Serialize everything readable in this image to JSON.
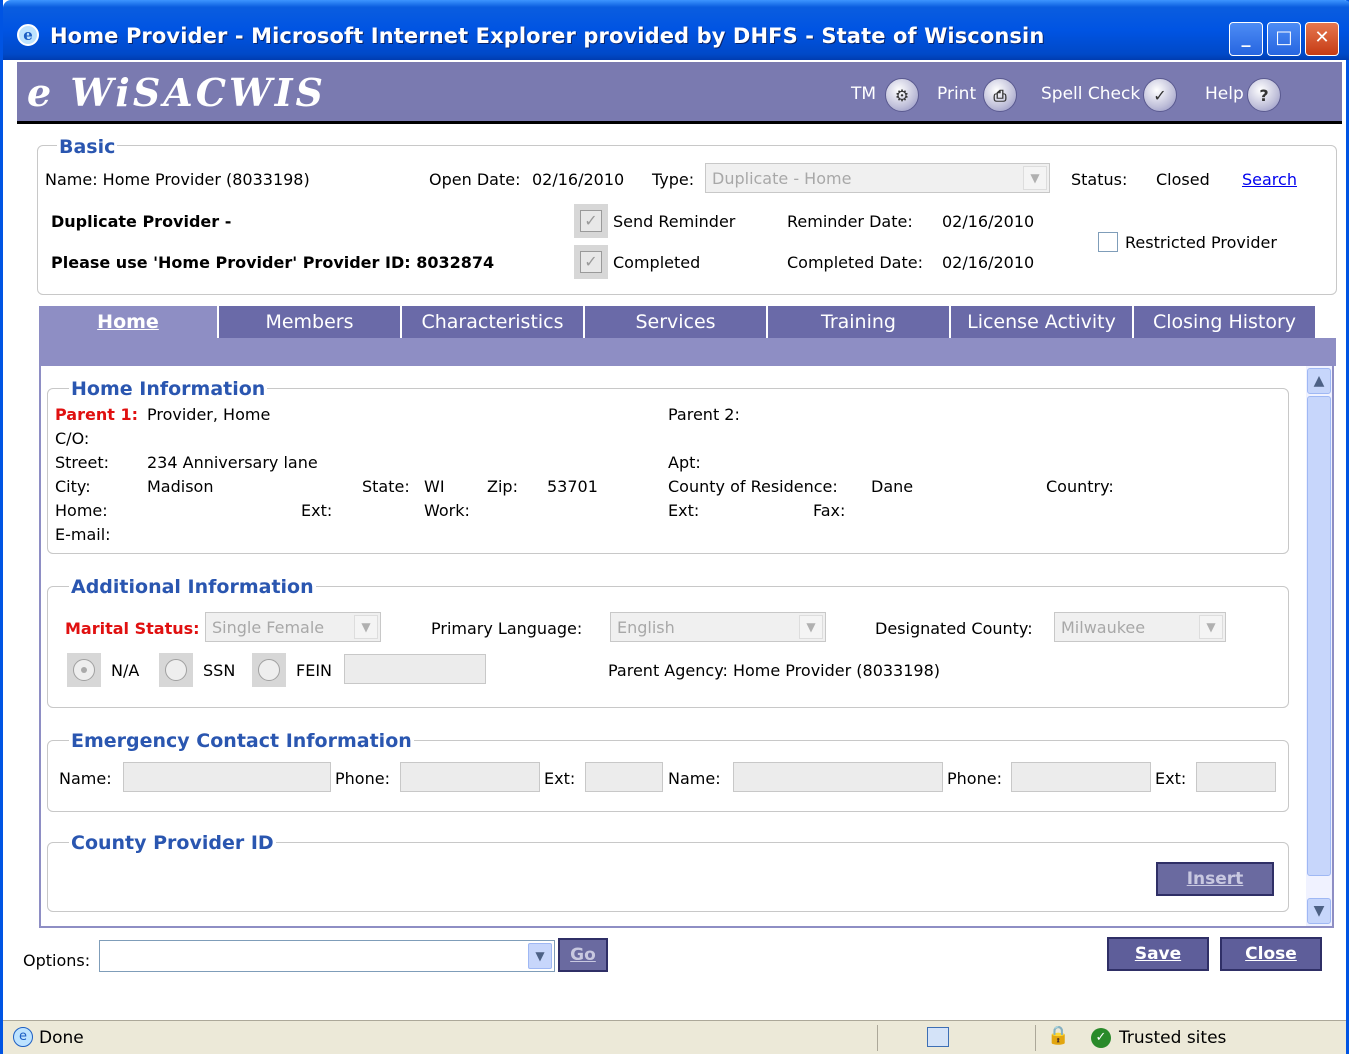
{
  "window": {
    "title": "Home Provider - Microsoft Internet Explorer provided by DHFS - State of Wisconsin",
    "minimize": "_",
    "maximize": "□",
    "close": "✕"
  },
  "header": {
    "logo": "e WiSACWIS",
    "links": {
      "tm": "TM",
      "print": "Print",
      "spell_check": "Spell Check",
      "help": "Help"
    }
  },
  "basic": {
    "legend": "Basic",
    "name": "Name:  Home Provider (8033198)",
    "open_date_label": "Open Date:",
    "open_date": "02/16/2010",
    "type_label": "Type:",
    "type_value": "Duplicate - Home",
    "status_label": "Status:",
    "status_value": "Closed",
    "search_link": "Search",
    "duplicate_line1": "Duplicate Provider -",
    "duplicate_line2": "Please use 'Home Provider' Provider ID: 8032874",
    "send_reminder": "Send Reminder",
    "completed": "Completed",
    "reminder_date_label": "Reminder Date:",
    "reminder_date": "02/16/2010",
    "completed_date_label": "Completed Date:",
    "completed_date": "02/16/2010",
    "restricted_provider": "Restricted Provider"
  },
  "tabs": [
    "Home",
    "Members",
    "Characteristics",
    "Services",
    "Training",
    "License Activity",
    "Closing History"
  ],
  "home_info": {
    "legend": "Home Information",
    "parent1_label": "Parent 1:",
    "parent1_value": "Provider, Home",
    "parent2_label": "Parent 2:",
    "co_label": "C/O:",
    "street_label": "Street:",
    "street_value": "234 Anniversary lane",
    "apt_label": "Apt:",
    "city_label": "City:",
    "city_value": "Madison",
    "state_label": "State:",
    "state_value": "WI",
    "zip_label": "Zip:",
    "zip_value": "53701",
    "county_label": "County of Residence:",
    "county_value": "Dane",
    "country_label": "Country:",
    "home_label": "Home:",
    "ext_label": "Ext:",
    "work_label": "Work:",
    "ext2_label": "Ext:",
    "fax_label": "Fax:",
    "email_label": "E-mail:"
  },
  "additional_info": {
    "legend": "Additional Information",
    "marital_label": "Marital Status:",
    "marital_value": "Single Female",
    "language_label": "Primary Language:",
    "language_value": "English",
    "county_label": "Designated County:",
    "county_value": "Milwaukee",
    "radio_na": "N/A",
    "radio_ssn": "SSN",
    "radio_fein": "FEIN",
    "parent_agency": "Parent Agency: Home Provider (8033198)"
  },
  "emergency": {
    "legend": "Emergency Contact Information",
    "name_label": "Name:",
    "phone_label": "Phone:",
    "ext_label": "Ext:"
  },
  "county_provider": {
    "legend": "County Provider ID",
    "insert_button": "Insert"
  },
  "footer": {
    "options_label": "Options:",
    "go_button": "Go",
    "save_button": "Save",
    "close_button": "Close"
  },
  "statusbar": {
    "done": "Done",
    "zone": "Trusted sites"
  }
}
